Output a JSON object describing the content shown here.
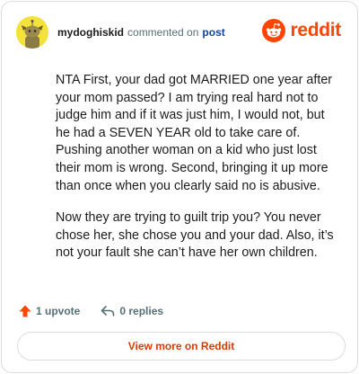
{
  "colors": {
    "brand": "#ff4500",
    "link": "#0a449b",
    "muted": "#576f76",
    "view_more": "#d93a00",
    "avatar_bg": "#f2e23a"
  },
  "header": {
    "avatar_icon": "snoo-avatar",
    "username": "mydoghiskid",
    "action_text": "commented on",
    "post_link": "post",
    "brand_icon": "reddit-logo-icon",
    "brand_word": "reddit"
  },
  "comment": {
    "paragraphs": [
      "NTA First, your dad got MARRIED one year after your mom passed? I am trying real hard not to judge him and if it was just him, I would not, but he had a SEVEN YEAR old to take care of. Pushing another woman on a kid who just lost their mom is wrong. Second, bringing it up more than once when you clearly said no is abusive.",
      "Now they are trying to guilt trip you? You never chose her, she chose you and your dad. Also, it’s not your fault she can’t have her own children."
    ]
  },
  "footer": {
    "upvote_icon": "upvote-arrow-icon",
    "upvote_label": "1 upvote",
    "reply_icon": "reply-arrow-icon",
    "replies_label": "0 replies",
    "view_more_label": "View more on Reddit"
  }
}
